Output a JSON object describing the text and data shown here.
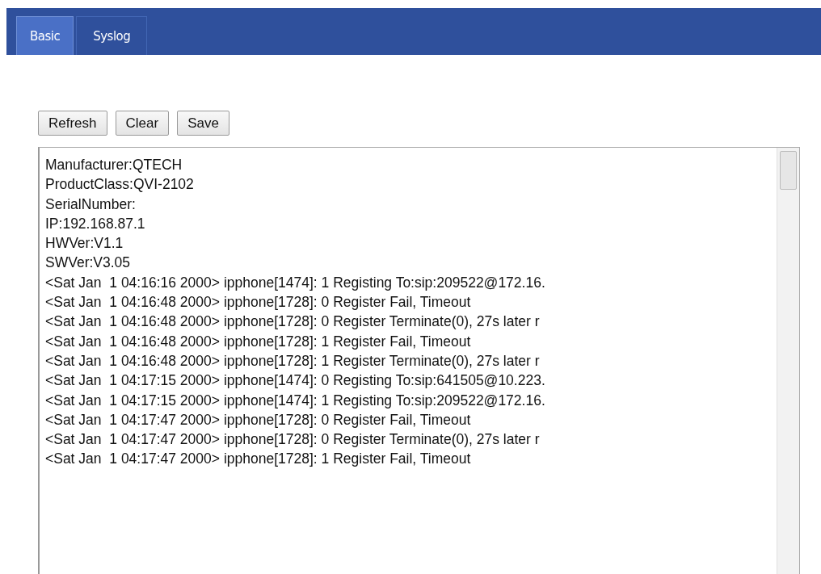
{
  "tabs": [
    {
      "label": "Basic",
      "selected": true
    },
    {
      "label": "Syslog",
      "selected": false
    }
  ],
  "buttons": [
    "Refresh",
    "Clear",
    "Save"
  ],
  "log_lines": [
    "Manufacturer:QTECH",
    "ProductClass:QVI-2102",
    "SerialNumber:",
    "IP:192.168.87.1",
    "HWVer:V1.1",
    "SWVer:V3.05",
    "<Sat Jan  1 04:16:16 2000> ipphone[1474]: 1 Registing To:sip:209522@172.16.",
    "<Sat Jan  1 04:16:48 2000> ipphone[1728]: 0 Register Fail, Timeout",
    "<Sat Jan  1 04:16:48 2000> ipphone[1728]: 0 Register Terminate(0), 27s later r",
    "<Sat Jan  1 04:16:48 2000> ipphone[1728]: 1 Register Fail, Timeout",
    "<Sat Jan  1 04:16:48 2000> ipphone[1728]: 1 Register Terminate(0), 27s later r",
    "<Sat Jan  1 04:17:15 2000> ipphone[1474]: 0 Registing To:sip:641505@10.223.",
    "<Sat Jan  1 04:17:15 2000> ipphone[1474]: 1 Registing To:sip:209522@172.16.",
    "<Sat Jan  1 04:17:47 2000> ipphone[1728]: 0 Register Fail, Timeout",
    "<Sat Jan  1 04:17:47 2000> ipphone[1728]: 0 Register Terminate(0), 27s later r",
    "<Sat Jan  1 04:17:47 2000> ipphone[1728]: 1 Register Fail, Timeout"
  ]
}
